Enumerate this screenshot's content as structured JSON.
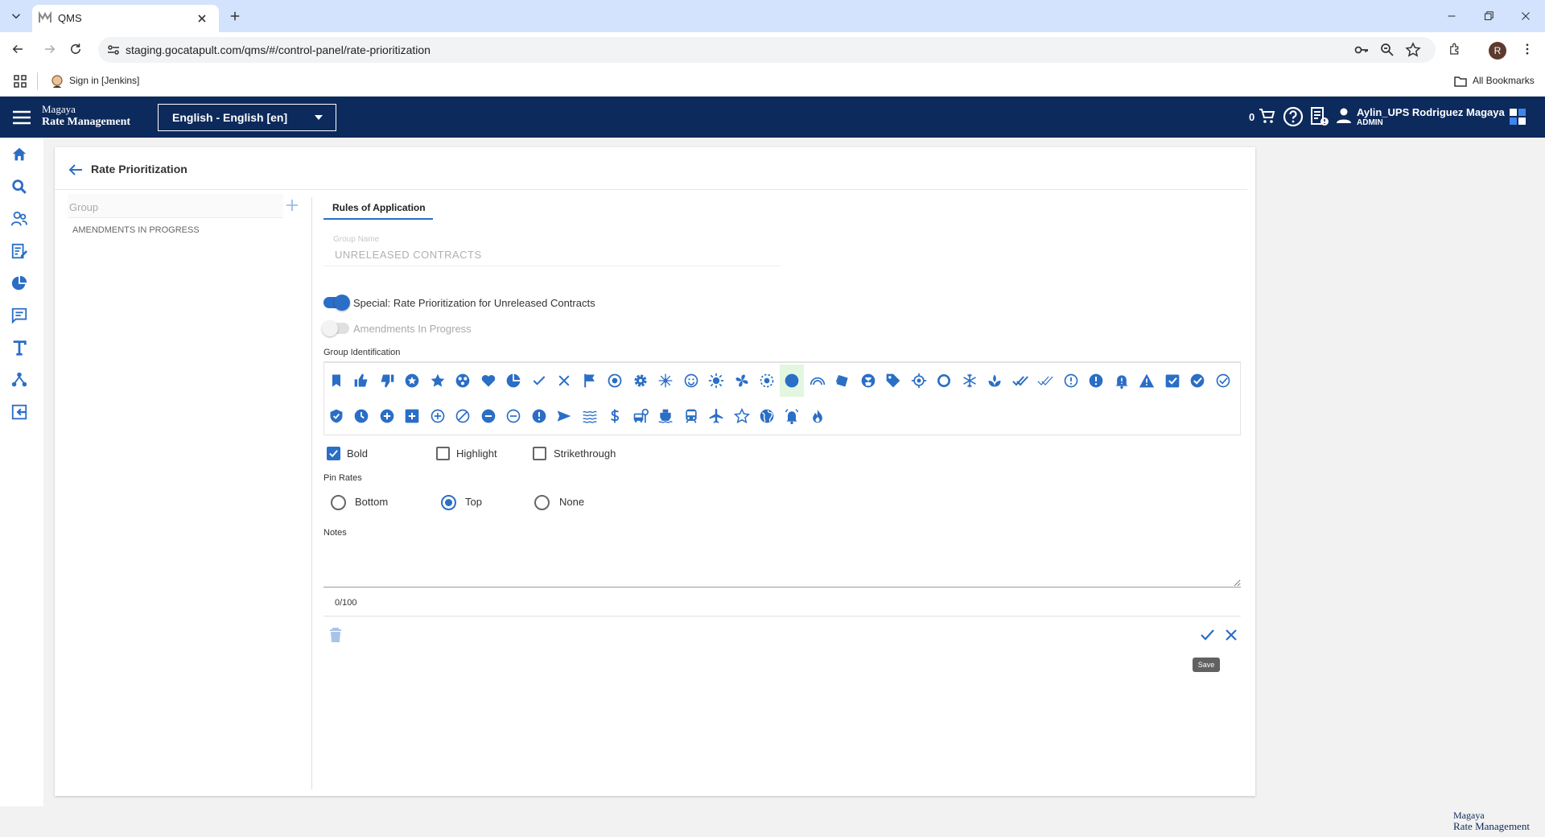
{
  "browser": {
    "tab_title": "QMS",
    "url": "staging.gocatapult.com/qms/#/control-panel/rate-prioritization",
    "bookmark_signin": "Sign in [Jenkins]",
    "all_bookmarks": "All Bookmarks",
    "profile_initial": "R"
  },
  "app": {
    "brand_line1": "Magaya",
    "brand_line2": "Rate Management",
    "language": "English - English [en]",
    "cart_count": "0",
    "user_name": "Aylin_UPS Rodriguez Magaya",
    "user_role": "ADMIN"
  },
  "page": {
    "title": "Rate Prioritization",
    "group_placeholder": "Group",
    "groups": [
      "AMENDMENTS IN PROGRESS"
    ],
    "tab_label": "Rules of Application",
    "group_name_label": "Group Name",
    "group_name_value": "UNRELEASED CONTRACTS",
    "toggle_special_label": "Special: Rate Prioritization for Unreleased Contracts",
    "toggle_special_on": true,
    "toggle_amend_label": "Amendments In Progress",
    "toggle_amend_on": false,
    "group_identification_label": "Group Identification",
    "selected_icon": "circle-filled",
    "icons_row1": [
      "bookmark",
      "thumb-up",
      "thumb-down",
      "stars-circle",
      "star",
      "bubbles",
      "heart",
      "pie-circle",
      "check",
      "close",
      "flag",
      "radio-button",
      "gear",
      "sparkle",
      "smile",
      "sun",
      "fan",
      "target-dotted",
      "circle-filled",
      "rainbow",
      "tilted-square",
      "flower-pot",
      "tag",
      "crosshair",
      "ring",
      "snowflake",
      "plant",
      "double-check",
      "double-check-thin",
      "exclamation-circle-outline",
      "exclamation-circle",
      "bell-alert",
      "warning",
      "checkbox",
      "check-circle",
      "check-circle-outline"
    ],
    "icons_row2": [
      "shield-check",
      "clock",
      "plus-circle",
      "plus-square",
      "plus-circle-outline",
      "block",
      "minus-circle",
      "minus-circle-outline",
      "error",
      "send",
      "waves",
      "dollar",
      "bus-stop",
      "boat",
      "train",
      "airplane",
      "star-outline",
      "globe",
      "bell-ring",
      "fire"
    ],
    "format_options": [
      {
        "label": "Bold",
        "checked": true
      },
      {
        "label": "Highlight",
        "checked": false
      },
      {
        "label": "Strikethrough",
        "checked": false
      }
    ],
    "pin_rates_label": "Pin Rates",
    "pin_options": [
      {
        "label": "Bottom",
        "selected": false
      },
      {
        "label": "Top",
        "selected": true
      },
      {
        "label": "None",
        "selected": false
      }
    ],
    "notes_label": "Notes",
    "notes_value": "",
    "char_counter": "0/100",
    "save_tooltip": "Save"
  },
  "colors": {
    "primary": "#2a6ec6",
    "appbar": "#0d2a5c",
    "chrome_tabstrip": "#d3e3fd",
    "selected_icon_bg": "#e3f6e0"
  }
}
